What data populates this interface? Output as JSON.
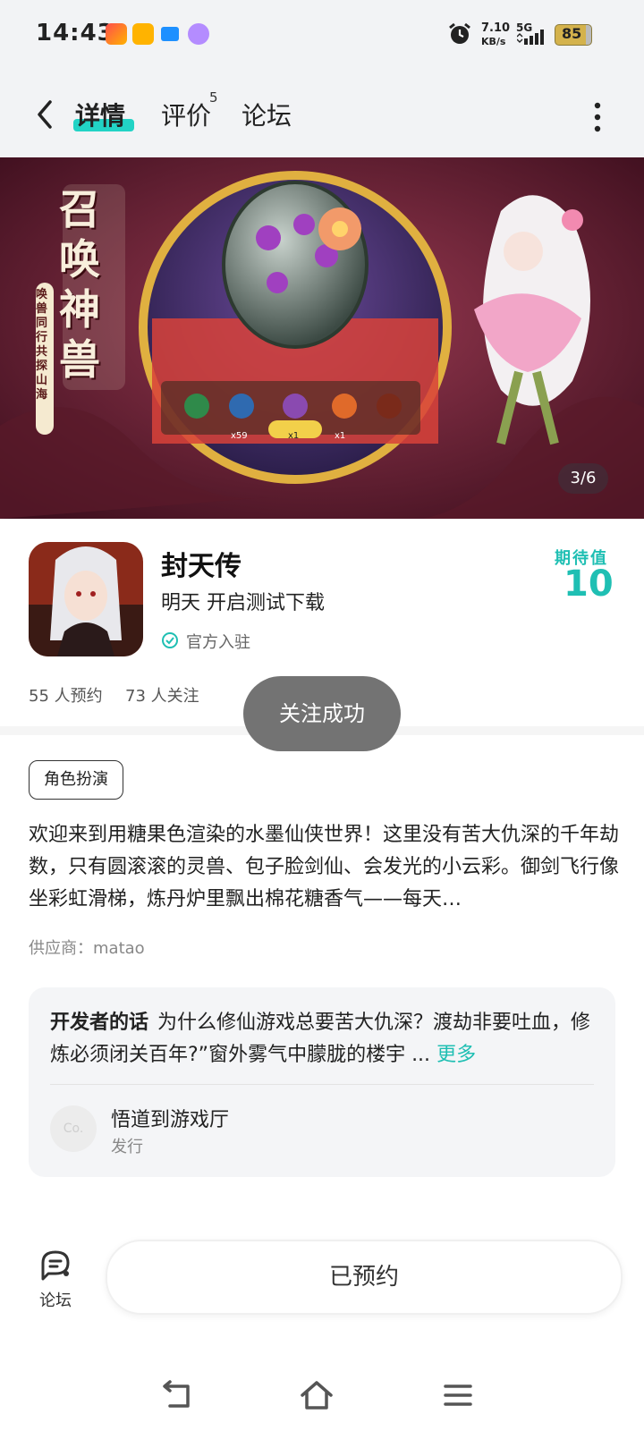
{
  "status_bar": {
    "time": "14:43",
    "net_speed_value": "7.10",
    "net_speed_unit": "KB/s",
    "network": "5G",
    "battery": "85"
  },
  "header": {
    "tabs": [
      {
        "label": "详情",
        "active": true
      },
      {
        "label": "评价",
        "badge": "5"
      },
      {
        "label": "论坛"
      }
    ],
    "accent_color": "#22d3c5"
  },
  "banner": {
    "vertical_text": "召唤神兽",
    "slogan": "唤兽同行 共探山海",
    "counter": "3/6",
    "egg_counts": [
      "x59",
      "x1",
      "x1"
    ]
  },
  "app": {
    "title": "封天传",
    "subtitle": "明天 开启测试下载",
    "official": "官方入驻",
    "expectation_label": "期待值",
    "expectation_value": "10",
    "reservations": "55 人预约",
    "followers": "73 人关注"
  },
  "toast": "关注成功",
  "tag": "角色扮演",
  "description": "欢迎来到用糖果色渲染的水墨仙侠世界！这里没有苦大仇深的千年劫数，只有圆滚滚的灵兽、包子脸剑仙、会发光的小云彩。御剑飞行像坐彩虹滑梯，炼丹炉里飘出棉花糖香气——每天…",
  "supplier": "供应商：matao",
  "developer": {
    "title": "开发者的话",
    "text": "为什么修仙游戏总要苦大仇深？渡劫非要吐血，修炼必须闭关百年?”窗外雾气中朦胧的楼宇 ...",
    "more": "更多",
    "publisher_avatar": "Co.",
    "publisher_name": "悟道到游戏厅",
    "publisher_role": "发行"
  },
  "bottom": {
    "forum_label": "论坛",
    "reserve_button": "已预约"
  }
}
